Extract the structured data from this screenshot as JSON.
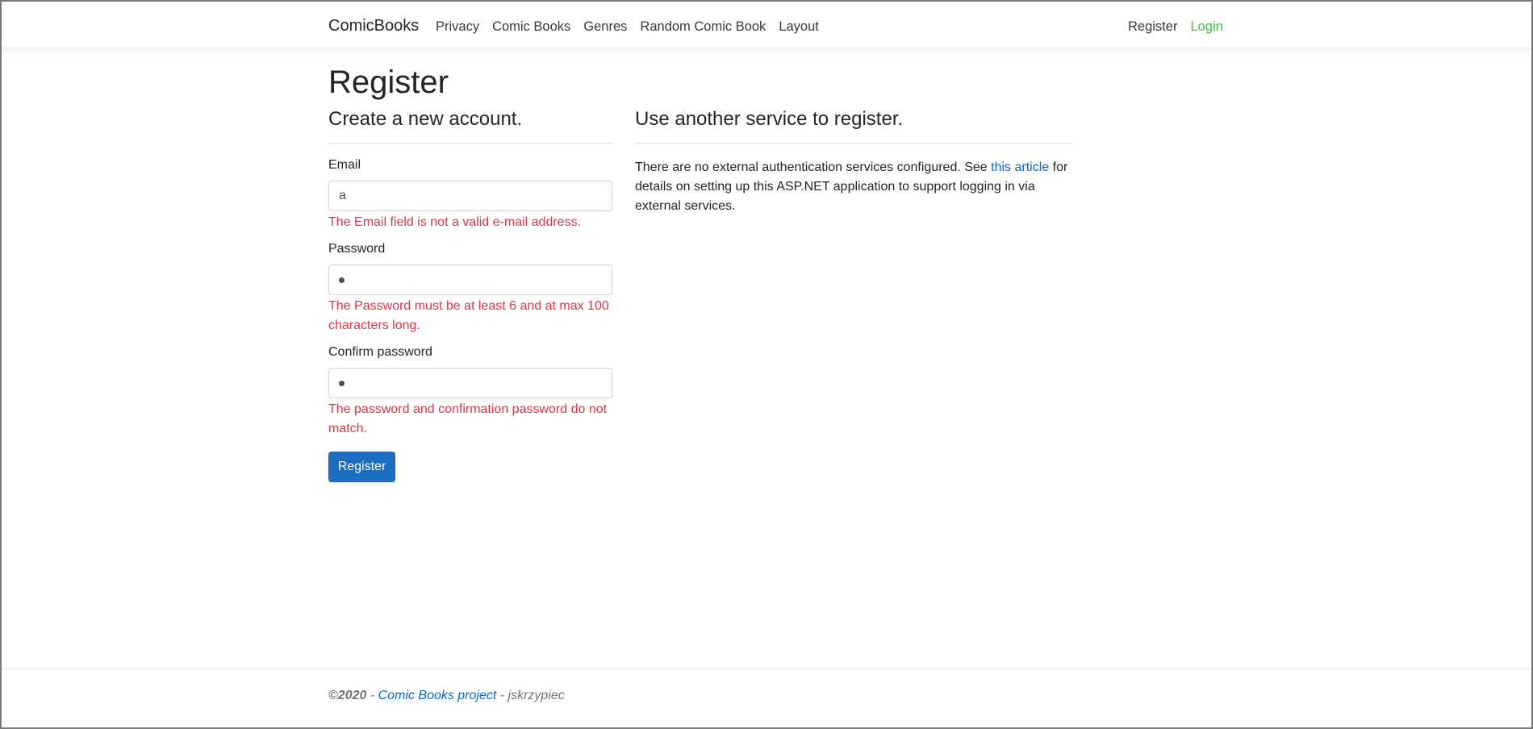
{
  "nav": {
    "brand": "ComicBooks",
    "links": [
      "Privacy",
      "Comic Books",
      "Genres",
      "Random Comic Book",
      "Layout"
    ],
    "register": "Register",
    "login": "Login"
  },
  "page": {
    "title": "Register",
    "left_heading": "Create a new account.",
    "right_heading": "Use another service to register."
  },
  "form": {
    "email_label": "Email",
    "email_value": "a",
    "email_error": "The Email field is not a valid e-mail address.",
    "password_label": "Password",
    "password_error": "The Password must be at least 6 and at max 100 characters long.",
    "confirm_label": "Confirm password",
    "confirm_error": "The password and confirmation password do not match.",
    "submit": "Register"
  },
  "external": {
    "text_before": "There are no external authentication services configured. See ",
    "link": "this article",
    "text_after": " for details on setting up this ASP.NET application to support logging in via external services."
  },
  "footer": {
    "copyright": "©2020",
    "sep1": " - ",
    "project_link": "Comic Books project",
    "sep2": " - ",
    "author": "jskrzypiec"
  }
}
